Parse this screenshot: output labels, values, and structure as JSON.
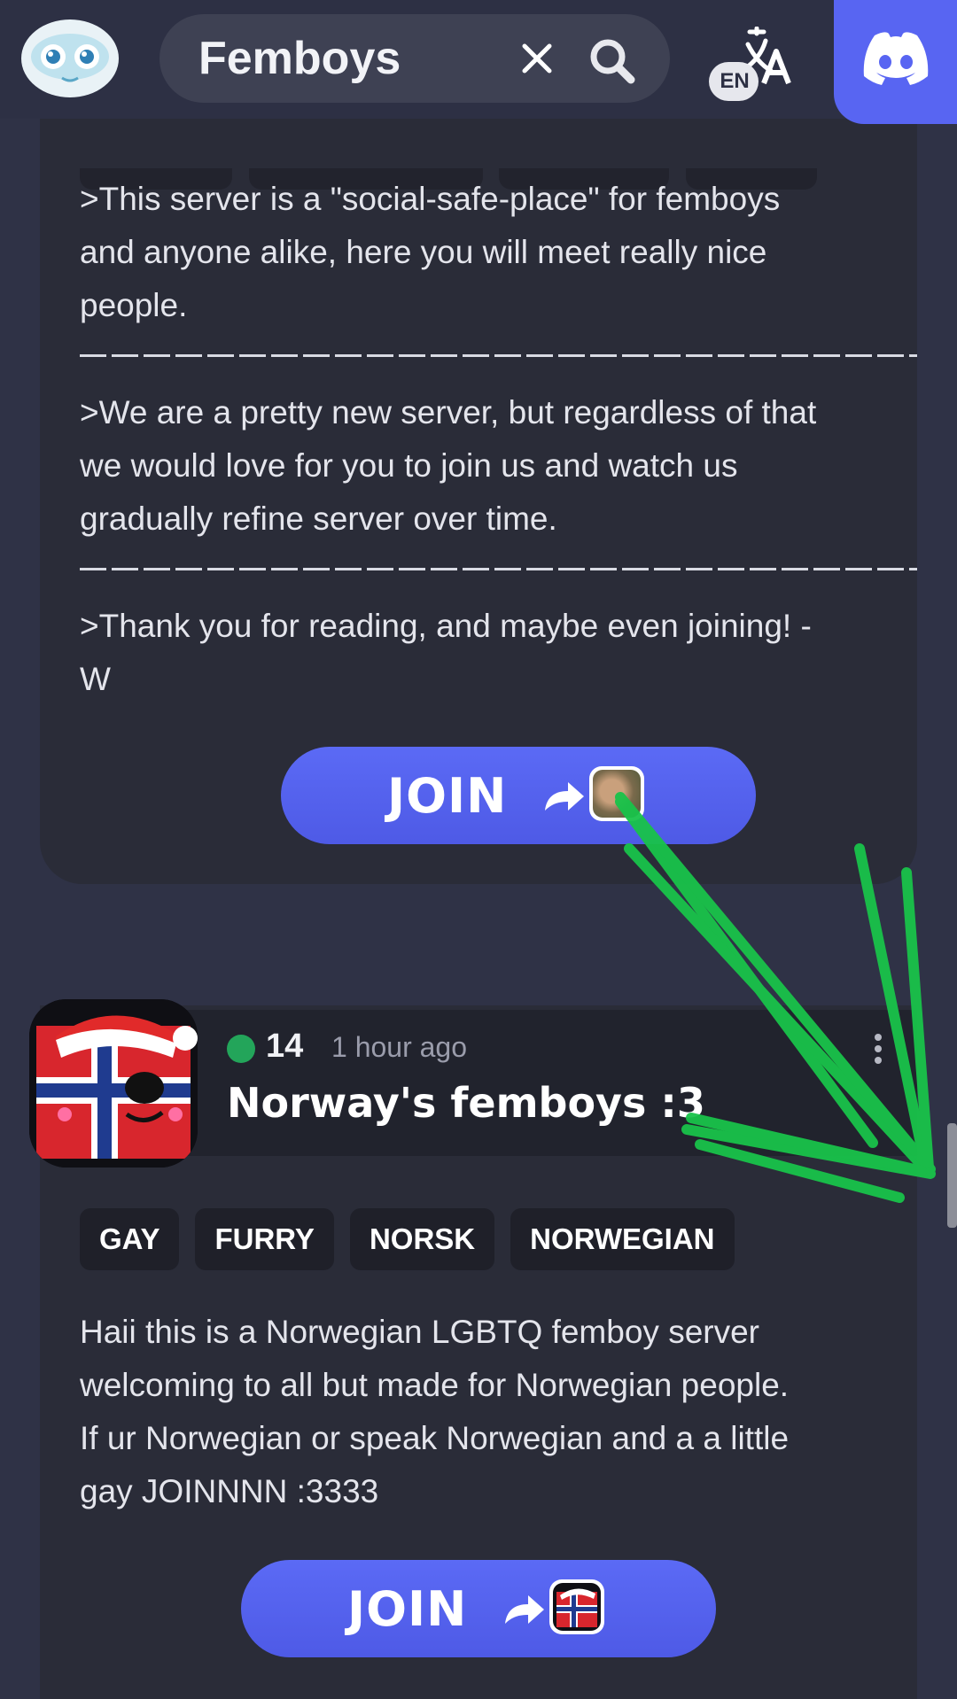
{
  "header": {
    "search_query": "Femboys",
    "translate_badge": "EN"
  },
  "card_top": {
    "paragraphs": [
      ">This server is a \"social-safe-place\" for femboys\nand anyone alike, here you will meet really nice\npeople.",
      ">We are a pretty new server, but regardless of that\nwe would love for you to join us and watch us\ngradually refine server over time.",
      ">Thank you for reading, and maybe even joining! -\nW"
    ],
    "join_label": "JOIN"
  },
  "card_server": {
    "online_count": "14",
    "time_ago": "1 hour ago",
    "name": "Norway's femboys :3",
    "tags": [
      "GAY",
      "FURRY",
      "NORSK",
      "NORWEGIAN"
    ],
    "description": "Haii this is a Norwegian LGBTQ femboy server\nwelcoming to all but made for Norwegian people.\nIf ur Norwegian or speak Norwegian and a a little\ngay JOINNNN :3333",
    "join_label": "JOIN"
  },
  "colors": {
    "background": "#2f3246",
    "card": "#2a2c38",
    "accent": "#5865f2",
    "online": "#23a55a",
    "annotation": "#19c34a"
  },
  "icons": [
    "robot-logo-icon",
    "clear-icon",
    "search-icon",
    "translate-icon",
    "discord-icon",
    "share-arrow-icon",
    "more-vertical-icon"
  ]
}
